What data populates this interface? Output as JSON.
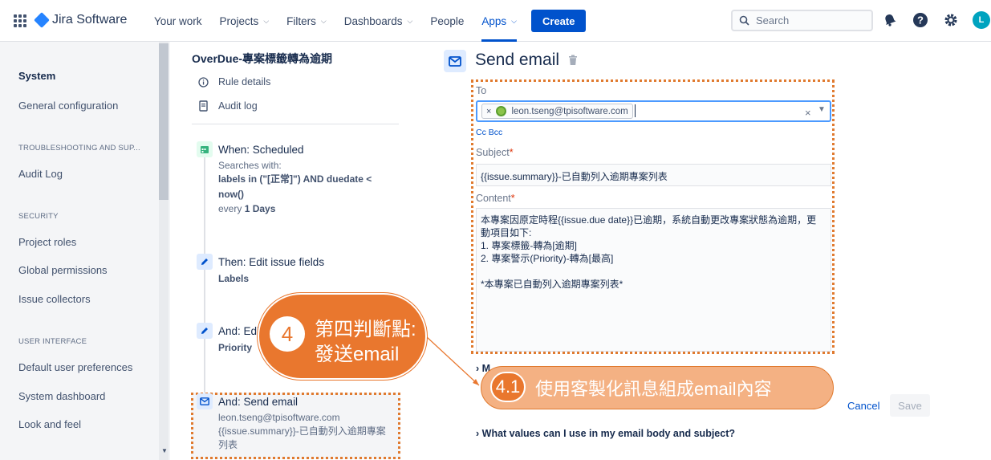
{
  "topnav": {
    "app_name": "Jira Software",
    "links": [
      {
        "label": "Your work",
        "has_chevron": false
      },
      {
        "label": "Projects",
        "has_chevron": true
      },
      {
        "label": "Filters",
        "has_chevron": true
      },
      {
        "label": "Dashboards",
        "has_chevron": true
      },
      {
        "label": "People",
        "has_chevron": false
      },
      {
        "label": "Apps",
        "has_chevron": true,
        "active": true
      }
    ],
    "create_label": "Create",
    "search_placeholder": "Search",
    "avatar_initial": "L",
    "icons": [
      "app-switcher-icon",
      "jira-logo-icon",
      "search-icon",
      "notifications-icon",
      "help-icon",
      "settings-icon"
    ]
  },
  "sidebar": {
    "items": [
      {
        "type": "item",
        "label": "System"
      },
      {
        "type": "item",
        "label": "General configuration"
      },
      {
        "type": "heading",
        "label": "TROUBLESHOOTING AND SUP..."
      },
      {
        "type": "item",
        "label": "Audit Log"
      },
      {
        "type": "heading",
        "label": "SECURITY"
      },
      {
        "type": "item",
        "label": "Project roles"
      },
      {
        "type": "item",
        "label": "Global permissions"
      },
      {
        "type": "item",
        "label": "Issue collectors"
      },
      {
        "type": "heading",
        "label": "USER INTERFACE"
      },
      {
        "type": "item",
        "label": "Default user preferences"
      },
      {
        "type": "item",
        "label": "System dashboard"
      },
      {
        "type": "item",
        "label": "Look and feel"
      }
    ]
  },
  "rule": {
    "title": "OverDue-專案標籤轉為逾期",
    "rule_details": "Rule details",
    "audit_log": "Audit log",
    "trigger": {
      "title": "When: Scheduled",
      "searches_with": "Searches with:",
      "jql_line1": "labels in (\"[正常]\") AND duedate <",
      "jql_line2": "now()",
      "every_prefix": "every",
      "every_value": "1 Days"
    },
    "action1": {
      "title": "Then: Edit issue fields",
      "detail": "Labels"
    },
    "action2": {
      "title": "And: Edi",
      "detail": "Priority"
    },
    "action3": {
      "title": "And: Send email",
      "line1": "leon.tseng@tpisoftware.com",
      "line2": "{{issue.summary}}-已自動列入逾期專案",
      "line3": "列表"
    }
  },
  "panel": {
    "title": "Send email",
    "to_label": "To",
    "to_recipient": "leon.tseng@tpisoftware.com",
    "cc_bcc": "Cc Bcc",
    "subject_label": "Subject",
    "subject_value": "{{issue.summary}}-已自動列入逾期專案列表",
    "content_label": "Content",
    "content_lines": [
      "本專案因原定時程{{issue.due date}}已逾期，系統自動更改專案狀態為逾期，更",
      "動項目如下:",
      "1. 專案標籤-轉為[逾期]",
      "2. 專案警示(Priority)-轉為[最高]",
      "",
      "*本專案已自動列入逾期專案列表*"
    ],
    "more_options_partial": "M",
    "values_help": "What values can I use in my email body and subject?",
    "cancel_label": "Cancel",
    "save_label": "Save"
  },
  "callouts": {
    "step4": {
      "number": "4",
      "line1": "第四判斷點:",
      "line2": "發送email"
    },
    "step41": {
      "number": "4.1",
      "text": "使用客製化訊息組成email內容"
    }
  },
  "colors": {
    "accent": "#0052cc",
    "annotation_orange": "#e9772e",
    "annotation_light": "#f4b183"
  }
}
